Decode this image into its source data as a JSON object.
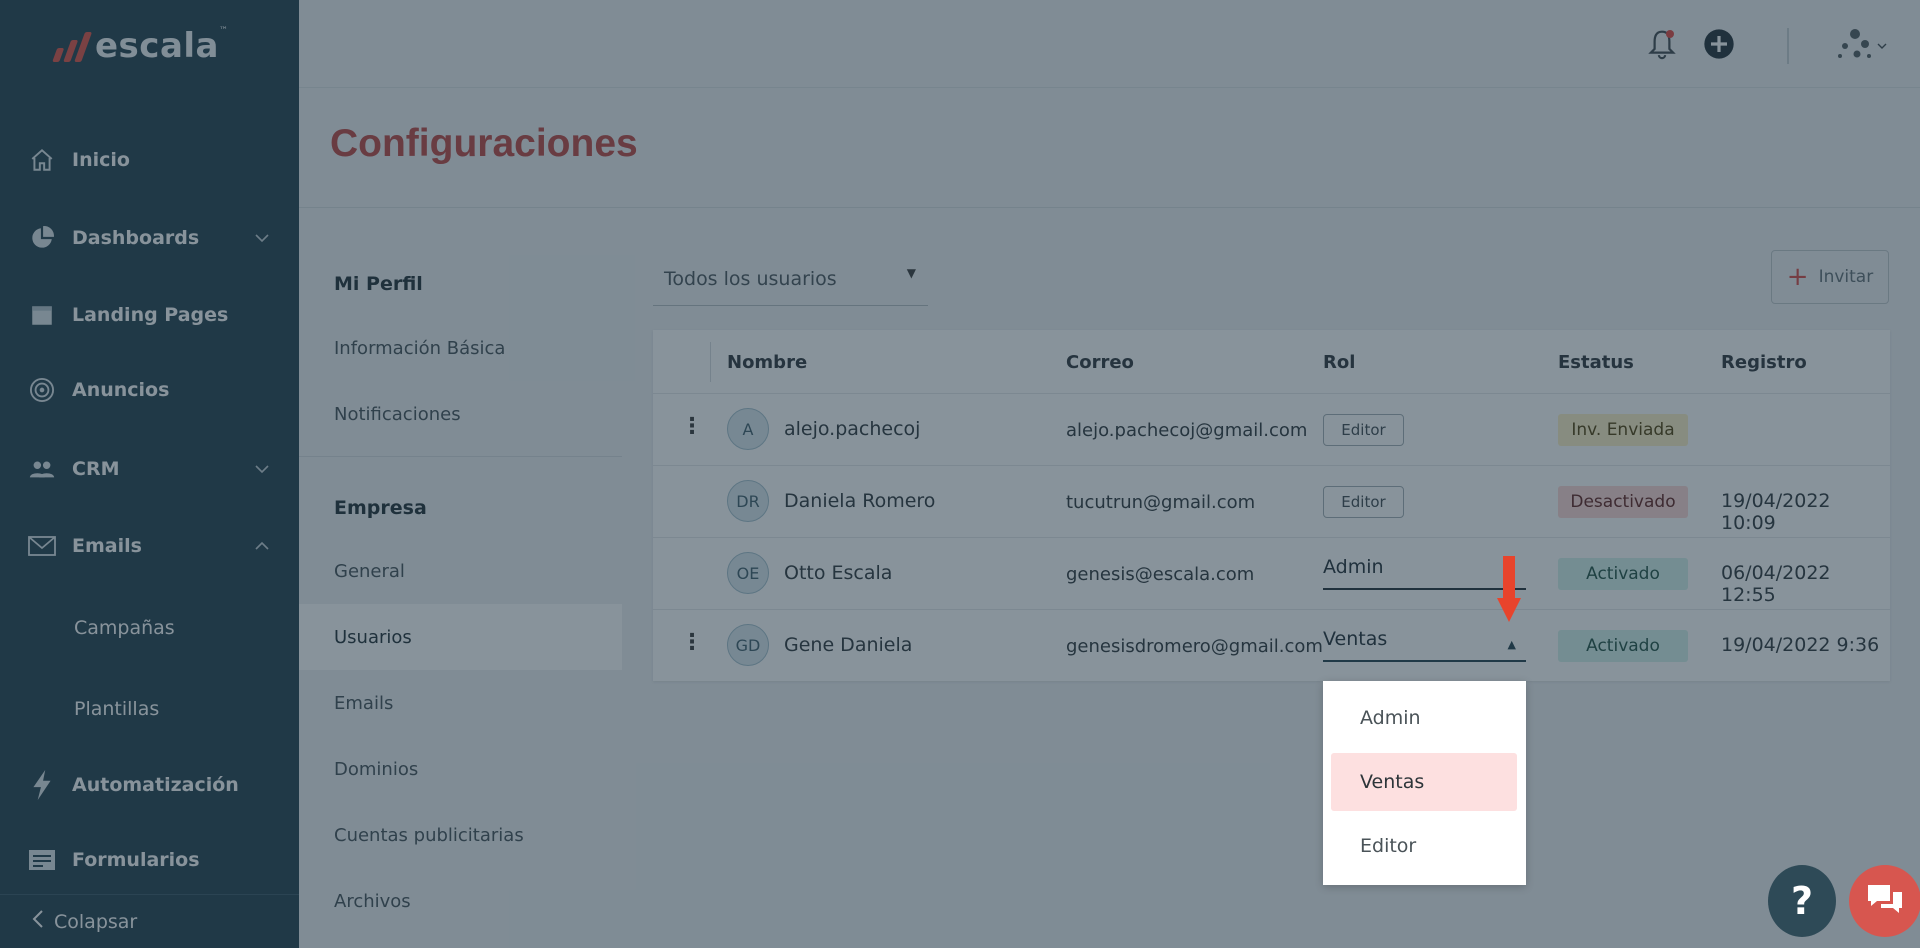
{
  "brand": {
    "name": "escala",
    "tm": "™",
    "accent": "#e25a4f"
  },
  "sidebar": {
    "items": [
      {
        "label": "Inicio",
        "icon": "home-icon"
      },
      {
        "label": "Dashboards",
        "icon": "pie-chart-icon",
        "chevron": "down"
      },
      {
        "label": "Landing Pages",
        "icon": "page-icon"
      },
      {
        "label": "Anuncios",
        "icon": "target-icon"
      },
      {
        "label": "CRM",
        "icon": "people-icon",
        "chevron": "down"
      },
      {
        "label": "Emails",
        "icon": "mail-icon",
        "chevron": "up"
      },
      {
        "label": "Campañas",
        "sub": true
      },
      {
        "label": "Plantillas",
        "sub": true
      },
      {
        "label": "Automatización",
        "icon": "bolt-icon"
      },
      {
        "label": "Formularios",
        "icon": "form-icon"
      }
    ],
    "collapse_label": "Colapsar"
  },
  "header": {
    "title": "Configuraciones"
  },
  "settings_nav": {
    "sections": [
      {
        "title": "Mi Perfil",
        "items": [
          "Información Básica",
          "Notificaciones"
        ]
      },
      {
        "title": "Empresa",
        "items": [
          "General",
          "Usuarios",
          "Emails",
          "Dominios",
          "Cuentas publicitarias",
          "Archivos"
        ]
      }
    ],
    "active": "Usuarios"
  },
  "filter": {
    "value": "Todos los usuarios"
  },
  "invite": {
    "label": "Invitar"
  },
  "table": {
    "columns": [
      "Nombre",
      "Correo",
      "Rol",
      "Estatus",
      "Registro"
    ],
    "rows": [
      {
        "initials": "A",
        "name": "alejo.pachecoj",
        "email": "alejo.pachecoj@gmail.com",
        "role": "Editor",
        "status": "Inv. Enviada",
        "registro": ""
      },
      {
        "initials": "DR",
        "name": "Daniela Romero",
        "email": "tucutrun@gmail.com",
        "role": "Editor",
        "status": "Desactivado",
        "registro": "19/04/2022 10:09"
      },
      {
        "initials": "OE",
        "name": "Otto Escala",
        "email": "genesis@escala.com",
        "role": "Admin",
        "status": "Activado",
        "registro": "06/04/2022 12:55"
      },
      {
        "initials": "GD",
        "name": "Gene Daniela",
        "email": "genesisdromero@gmail.com",
        "role": "Ventas",
        "status": "Activado",
        "registro": "19/04/2022 9:36"
      }
    ]
  },
  "role_menu": {
    "options": [
      "Admin",
      "Ventas",
      "Editor"
    ],
    "selected": "Ventas"
  },
  "help": {
    "label": "?"
  },
  "colors": {
    "sidebar": "#2e4a57",
    "title": "#c0504c",
    "status_sent": "#fdf1c9",
    "status_off": "#fcd8d6",
    "status_on": "#d7f2ec",
    "arrow": "#e8442c"
  }
}
